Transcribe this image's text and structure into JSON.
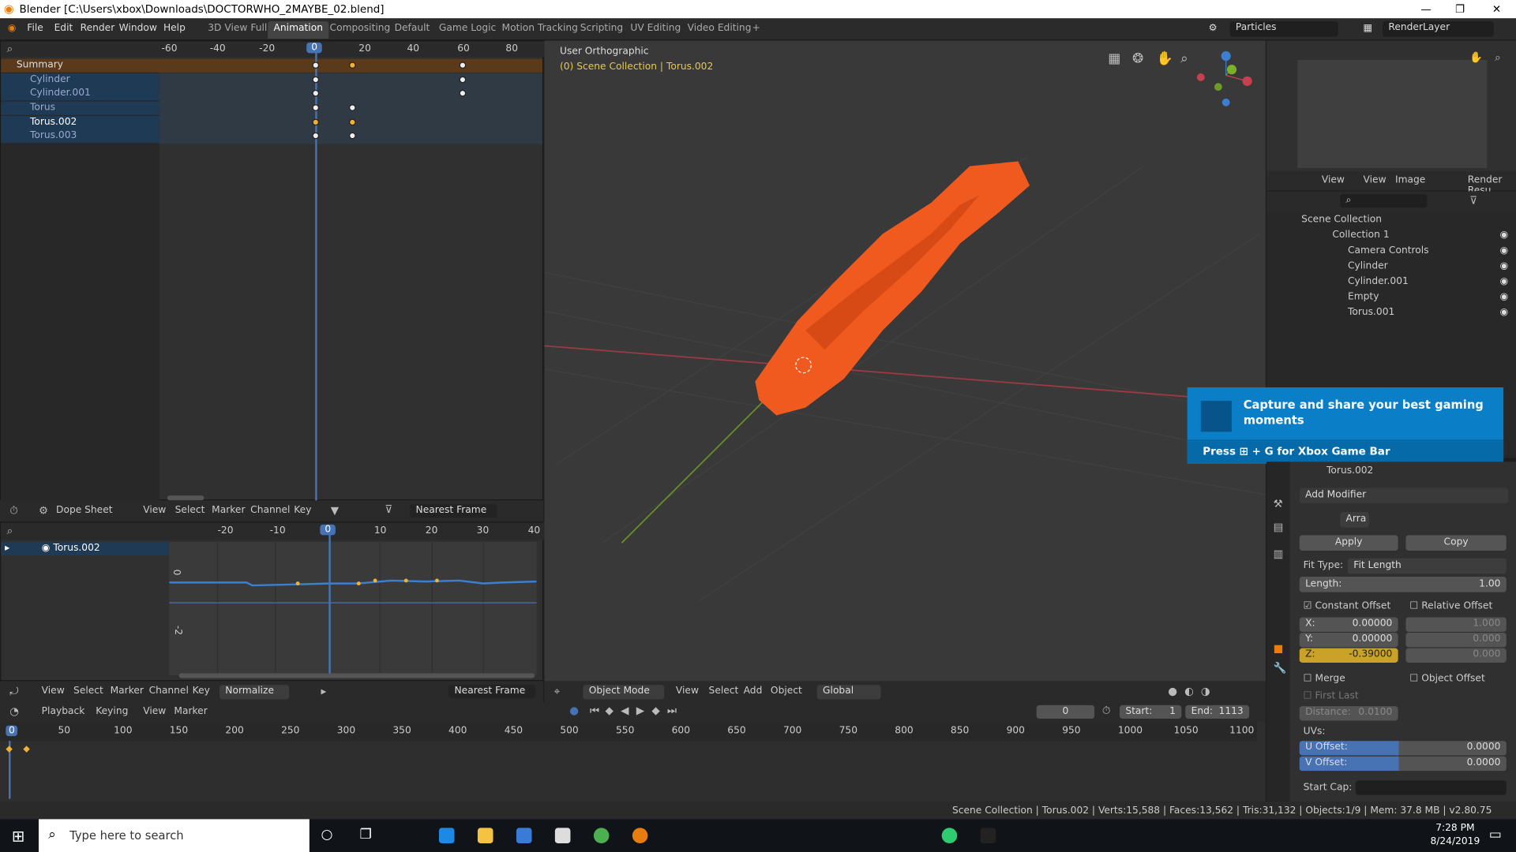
{
  "window": {
    "title": "Blender [C:\\Users\\xbox\\Downloads\\DOCTORWHO_2MAYBE_02.blend]"
  },
  "menu": {
    "items": [
      "File",
      "Edit",
      "Render",
      "Window",
      "Help"
    ]
  },
  "workspaces": [
    "3D View Full",
    "Animation",
    "Compositing",
    "Default",
    "Game Logic",
    "Motion Tracking",
    "Scripting",
    "UV Editing",
    "Video Editing",
    "+"
  ],
  "scene": {
    "name": "Particles",
    "layer": "RenderLayer"
  },
  "dopesheet_top": {
    "ruler": [
      "-60",
      "-40",
      "-20",
      "0",
      "20",
      "40",
      "60",
      "80"
    ],
    "current_frame": "0",
    "channels": [
      "Summary",
      "Cylinder",
      "Cylinder.001",
      "Torus",
      "Torus.002",
      "Torus.003"
    ]
  },
  "dopesheet_header": {
    "mode": "Dope Sheet",
    "menus": [
      "View",
      "Select",
      "Marker",
      "Channel",
      "Key"
    ],
    "snap": "Nearest Frame"
  },
  "graph": {
    "ruler": [
      "-20",
      "-10",
      "0",
      "10",
      "20",
      "30",
      "40"
    ],
    "current_frame": "0",
    "channel": "Torus.002",
    "yvals": [
      "0",
      "-2"
    ]
  },
  "graph_header": {
    "menus": [
      "View",
      "Select",
      "Marker",
      "Channel",
      "Key"
    ],
    "normalize": "Normalize",
    "snap": "Nearest Frame"
  },
  "viewport": {
    "view": "User Orthographic",
    "collection": "(0) Scene Collection | Torus.002",
    "mode": "Object Mode",
    "menus": [
      "View",
      "Select",
      "Add",
      "Object"
    ],
    "orientation": "Global"
  },
  "timeline": {
    "menus": [
      "Playback",
      "Keying",
      "View",
      "Marker"
    ],
    "frame": "0",
    "start_label": "Start:",
    "start": "1",
    "end_label": "End:",
    "end": "1113",
    "ruler": [
      "0",
      "50",
      "100",
      "150",
      "200",
      "250",
      "300",
      "350",
      "400",
      "450",
      "500",
      "550",
      "600",
      "650",
      "700",
      "750",
      "800",
      "850",
      "900",
      "950",
      "1000",
      "1050",
      "1100"
    ]
  },
  "image_editor": {
    "menus": [
      "View",
      "View",
      "Image"
    ],
    "result": "Render Resu"
  },
  "outliner": {
    "root": "Scene Collection",
    "items": [
      "Collection 1",
      "Camera Controls",
      "Cylinder",
      "Cylinder.001",
      "Empty",
      "Torus.001"
    ]
  },
  "xbox": {
    "title": "Capture and share your best gaming moments",
    "hint_pre": "Press",
    "hint_post": "+ G for Xbox Game Bar"
  },
  "properties": {
    "object": "Torus.002",
    "add_modifier": "Add Modifier",
    "modifier_name": "Arra",
    "apply": "Apply",
    "copy": "Copy",
    "fit_type_label": "Fit Type:",
    "fit_type": "Fit Length",
    "length_label": "Length:",
    "length": "1.00",
    "constant_offset": "Constant Offset",
    "relative_offset": "Relative Offset",
    "x_label": "X:",
    "x": "0.00000",
    "y_label": "Y:",
    "y": "0.00000",
    "z_label": "Z:",
    "z": "-0.39000",
    "rx": "1.000",
    "ry": "0.000",
    "rz": "0.000",
    "merge": "Merge",
    "object_offset": "Object Offset",
    "first_last": "First Last",
    "distance_label": "Distance:",
    "distance": "0.0100",
    "uvs": "UVs:",
    "u_offset_label": "U Offset:",
    "u_offset": "0.0000",
    "v_offset_label": "V Offset:",
    "v_offset": "0.0000",
    "start_cap": "Start Cap:"
  },
  "statusbar": {
    "text": "Scene Collection | Torus.002 | Verts:15,588 | Faces:13,562 | Tris:31,132 | Objects:1/9 | Mem: 37.8 MB | v2.80.75"
  },
  "taskbar": {
    "search": "Type here to search",
    "time": "7:28 PM",
    "date": "8/24/2019"
  },
  "colors": {
    "accent": "#4772b3",
    "object_orange": "#f05a1e",
    "key_selected": "#f4b030",
    "xbox_blue": "#0a7fc8"
  }
}
